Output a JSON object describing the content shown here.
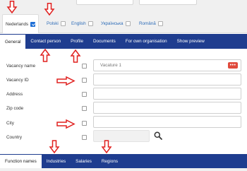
{
  "languages": [
    {
      "label": "Nederlands",
      "checked": true
    },
    {
      "label": "Polski",
      "checked": false
    },
    {
      "label": "English",
      "checked": false
    },
    {
      "label": "Українська",
      "checked": false
    },
    {
      "label": "Română",
      "checked": false
    }
  ],
  "primary_tabs": [
    "General",
    "Contact person",
    "Profile",
    "Documents",
    "For own organisation",
    "Show preview"
  ],
  "form": {
    "rows": [
      {
        "label": "Vacancy name",
        "value": "Vacature 1"
      },
      {
        "label": "Vacancy ID",
        "value": ""
      },
      {
        "label": "Address",
        "value": ""
      },
      {
        "label": "Zip code",
        "value": ""
      },
      {
        "label": "City",
        "value": ""
      },
      {
        "label": "Country",
        "value": ""
      }
    ],
    "dots_button_label": "•••"
  },
  "secondary_tabs": [
    "Function names",
    "Industries",
    "Salaries",
    "Regions"
  ],
  "colors": {
    "nav": "#1f3d8f",
    "accent": "#1f6fd6",
    "arrow": "#e0201f",
    "dots_button": "#e04a3c"
  },
  "icons": {
    "search": "search-icon",
    "dots": "more-dots-icon",
    "arrow": "red-arrow-annotation"
  }
}
